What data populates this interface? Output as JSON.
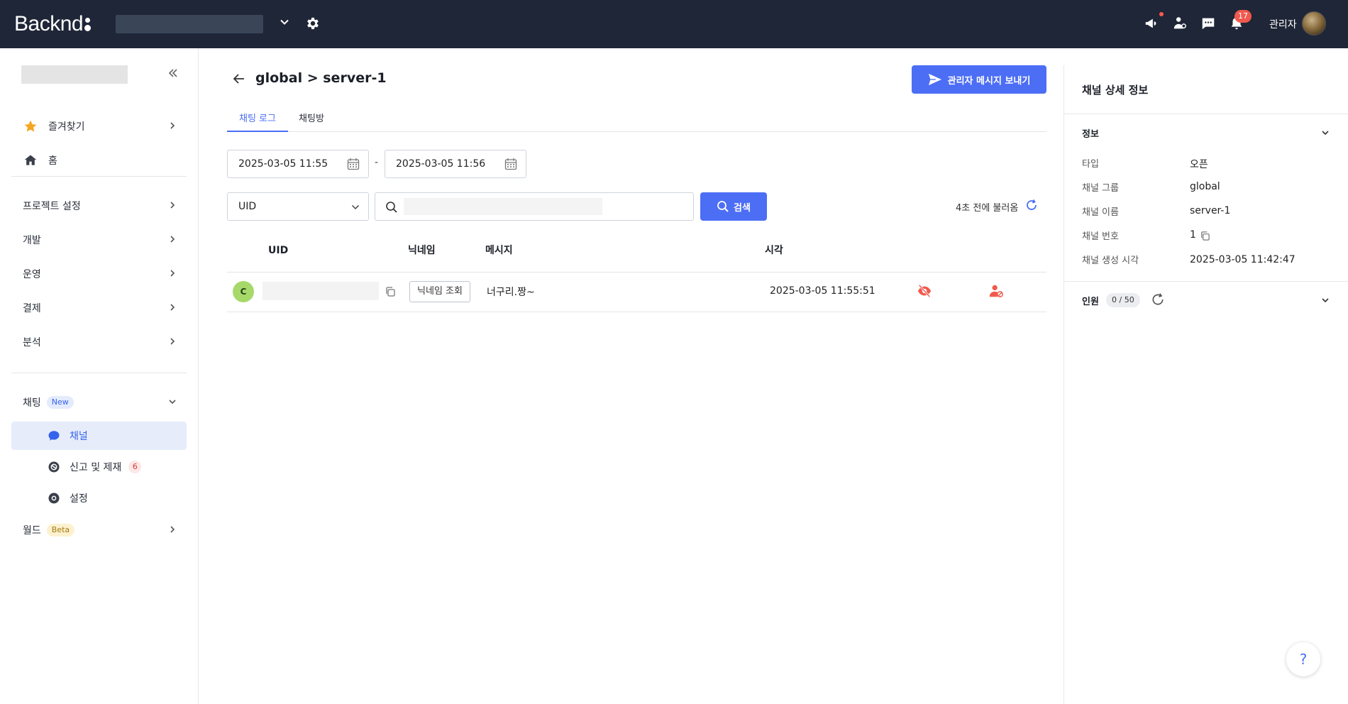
{
  "header": {
    "logo_text": "Backnd",
    "notification_count": "17",
    "admin_label": "관리자",
    "icons": [
      "megaphone-icon",
      "share-user-icon",
      "chat-icon",
      "bell-icon"
    ]
  },
  "sidebar": {
    "items": [
      {
        "label": "즐겨찾기",
        "icon": "star-icon"
      },
      {
        "label": "홈",
        "icon": "home-icon"
      },
      {
        "label": "프로젝트 설정"
      },
      {
        "label": "개발"
      },
      {
        "label": "운영"
      },
      {
        "label": "결제"
      },
      {
        "label": "분석"
      }
    ],
    "chatting": {
      "label": "채팅",
      "badge": "New",
      "sub_items": [
        {
          "label": "채널",
          "icon": "chat-bubble-icon",
          "active": true
        },
        {
          "label": "신고 및 제재",
          "icon": "report-icon",
          "count": "6"
        },
        {
          "label": "설정",
          "icon": "settings-icon"
        }
      ]
    },
    "world": {
      "label": "월드",
      "badge": "Beta"
    }
  },
  "main": {
    "title": "global > server-1",
    "send_button": "관리자 메시지 보내기",
    "tabs": [
      {
        "label": "채팅 로그",
        "active": true
      },
      {
        "label": "채팅방",
        "active": false
      }
    ],
    "date_from": "2025-03-05 11:55",
    "date_separator": "-",
    "date_to": "2025-03-05 11:56",
    "filter_select": "UID",
    "search_value": "",
    "search_button": "검색",
    "refresh_text": "4초 전에 불러옴",
    "columns": [
      "UID",
      "닉네임",
      "메시지",
      "시각"
    ],
    "rows": [
      {
        "avatar_letter": "C",
        "uid": "",
        "nickname_button": "닉네임 조회",
        "message": "너구리.짱~",
        "time": "2025-03-05 11:55:51"
      }
    ]
  },
  "panel": {
    "title": "채널 상세 정보",
    "info_section": "정보",
    "info": [
      {
        "label": "타입",
        "value": "오픈"
      },
      {
        "label": "채널 그룹",
        "value": "global"
      },
      {
        "label": "채널 이름",
        "value": "server-1"
      },
      {
        "label": "채널 번호",
        "value": "1"
      },
      {
        "label": "채널 생성 시각",
        "value": "2025-03-05 11:42:47"
      }
    ],
    "members_section": "인원",
    "members_count": "0 / 50"
  },
  "help_label": "?",
  "colors": {
    "header_bg": "#1f2637",
    "accent": "#4c6ef5",
    "alert": "#f0594d"
  }
}
